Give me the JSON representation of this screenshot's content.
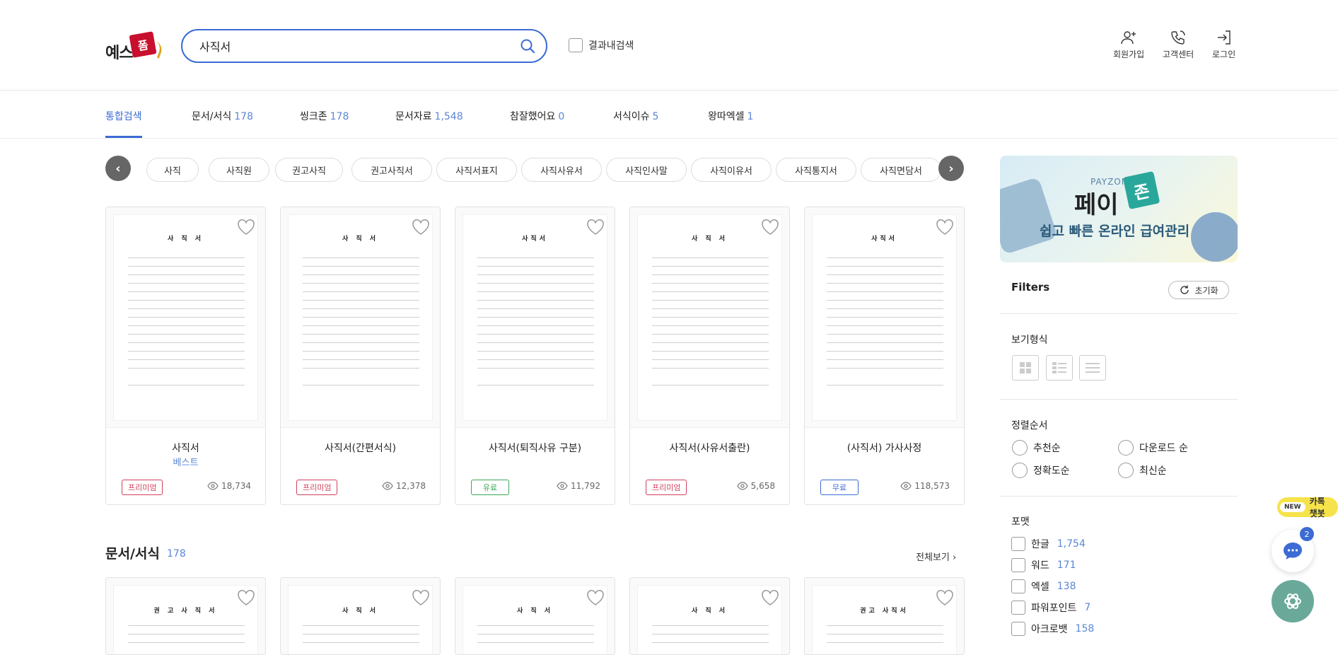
{
  "header": {
    "logo_text": "예스",
    "logo_badge": "폼",
    "search_value": "사직서",
    "in_result_label": "결과내검색",
    "utils": [
      {
        "label": "회원가입",
        "icon": "user-plus-icon"
      },
      {
        "label": "고객센터",
        "icon": "phone-icon"
      },
      {
        "label": "로그인",
        "icon": "login-icon"
      }
    ]
  },
  "tabs": [
    {
      "label": "통합검색",
      "count": ""
    },
    {
      "label": "문서/서식",
      "count": "178"
    },
    {
      "label": "씽크존",
      "count": "178"
    },
    {
      "label": "문서자료",
      "count": "1,548"
    },
    {
      "label": "참잘했어요",
      "count": "0"
    },
    {
      "label": "서식이슈",
      "count": "5"
    },
    {
      "label": "왕따엑셀",
      "count": "1"
    }
  ],
  "keywords": [
    "사직",
    "사직원",
    "권고사직",
    "권고사직서",
    "사직서표지",
    "사직사유서",
    "사직인사말",
    "사직이유서",
    "사직통지서",
    "사직면담서"
  ],
  "cards": [
    {
      "title": "사직서",
      "sub": "베스트",
      "badge": "프리미엄",
      "views": "18,734",
      "doc": "사 직 서"
    },
    {
      "title": "사직서(간편서식)",
      "sub": "",
      "badge": "프리미엄",
      "views": "12,378",
      "doc": "사 직 서"
    },
    {
      "title": "사직서(퇴직사유 구분)",
      "sub": "",
      "badge": "유료",
      "views": "11,792",
      "doc": "사직서"
    },
    {
      "title": "사직서(사유서출란)",
      "sub": "",
      "badge": "프리미엄",
      "views": "5,658",
      "doc": "사 직 서"
    },
    {
      "title": "(사직서) 가사사정",
      "sub": "",
      "badge": "무료",
      "views": "118,573",
      "doc": "사직서"
    }
  ],
  "section": {
    "title": "문서/서식",
    "count": "178",
    "view_all": "전체보기"
  },
  "cards2": [
    {
      "doc": "권 고 사 직 서"
    },
    {
      "doc": "사 직 서"
    },
    {
      "doc": "사 직 서"
    },
    {
      "doc": "사 직 서"
    },
    {
      "doc": "권고 사직서"
    }
  ],
  "banner": {
    "brand": "PAYZON",
    "name": "페이",
    "name_badge": "존",
    "slogan": "쉽고 빠른 온라인 급여관리"
  },
  "filters": {
    "title": "Filters",
    "reset": "초기화",
    "view_label": "보기형식",
    "sort_label": "정렬순서",
    "sort_options": [
      "추천순",
      "다운로드 순",
      "정확도순",
      "최신순"
    ],
    "format_label": "포맷",
    "formats": [
      {
        "label": "한글",
        "count": "1,754"
      },
      {
        "label": "워드",
        "count": "171"
      },
      {
        "label": "엑셀",
        "count": "138"
      },
      {
        "label": "파워포인트",
        "count": "7"
      },
      {
        "label": "아크로뱃",
        "count": "158"
      }
    ]
  },
  "widgets": {
    "kakao_new": "NEW",
    "kakao_label": "카톡 챗봇",
    "chat_count": "2"
  },
  "colors": {
    "accent": "#3c6bd4",
    "count": "#5b86d6",
    "premium": "#d0405e",
    "paid": "#3aa655",
    "free": "#3c6bd4"
  }
}
